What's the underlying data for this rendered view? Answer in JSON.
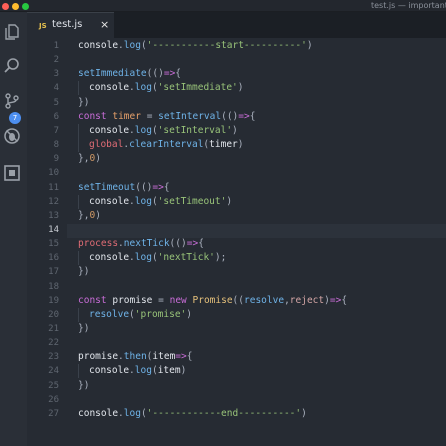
{
  "window": {
    "title": "test.js — important_"
  },
  "activity_bar": {
    "icons": [
      "files-icon",
      "search-icon",
      "source-control-icon",
      "no-bugs-icon",
      "extensions-icon"
    ],
    "badge": "7"
  },
  "tab": {
    "lang": "JS",
    "name": "test.js",
    "close": "×"
  },
  "editor": {
    "active_line": 14,
    "line_numbers": [
      "1",
      "2",
      "3",
      "4",
      "5",
      "6",
      "7",
      "8",
      "9",
      "10",
      "11",
      "12",
      "13",
      "14",
      "15",
      "16",
      "17",
      "18",
      "19",
      "20",
      "21",
      "22",
      "23",
      "24",
      "25",
      "26",
      "27"
    ],
    "lines": [
      "console.log('-----------start----------')",
      "",
      "setImmediate(()=>{",
      "  console.log('setImmediate')",
      "})",
      "const timer = setInterval(()=>{",
      "  console.log('setInterval')",
      "  global.clearInterval(timer)",
      "},0)",
      "",
      "setTimeout(()=>{",
      "  console.log('setTimeout')",
      "},0)",
      "",
      "process.nextTick(()=>{",
      "  console.log('nextTick');",
      "})",
      "",
      "const promise = new Promise((resolve,reject)=>{",
      "  resolve('promise')",
      "})",
      "",
      "promise.then(item=>{",
      "  console.log(item)",
      "})",
      "",
      "console.log('------------end----------')"
    ]
  },
  "colors": {
    "background": "#262b33",
    "string": "#98c379",
    "keyword": "#c96dd8",
    "function": "#6fb3e8",
    "badge": "#4d8ff0"
  }
}
